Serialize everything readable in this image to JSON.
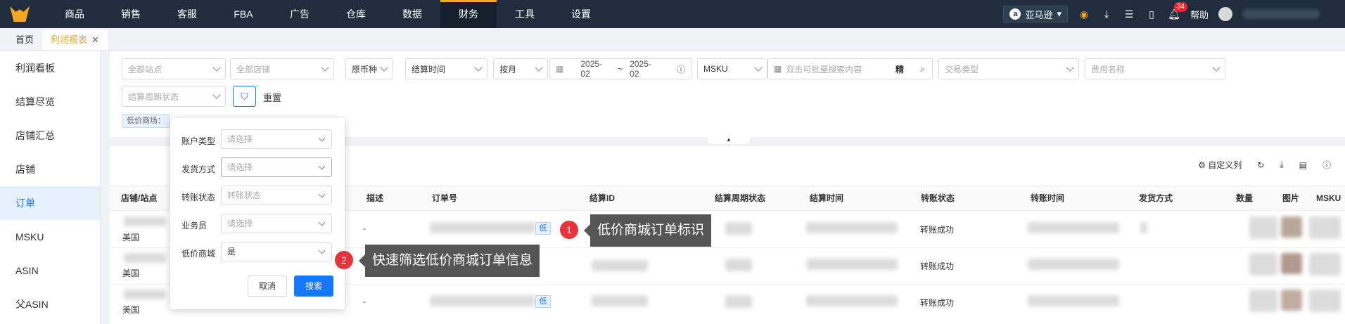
{
  "nav": [
    "商品",
    "销售",
    "客服",
    "FBA",
    "广告",
    "仓库",
    "数据",
    "财务",
    "工具",
    "设置"
  ],
  "nav_active": "财务",
  "topright": {
    "store": "亚马逊",
    "help": "帮助",
    "badge": "34"
  },
  "tabs": {
    "home": "首页",
    "current": "利润报表",
    "close": "✕"
  },
  "sidebar": [
    "利润看板",
    "结算尽览",
    "店铺汇总",
    "店铺",
    "订单",
    "MSKU",
    "ASIN",
    "父ASIN"
  ],
  "sidebar_active": "订单",
  "filters": {
    "site": "全部站点",
    "shop": "全部店铺",
    "currency": "原币种",
    "time_type": "结算时间",
    "period": "按月",
    "date_from": "2025-02",
    "date_sep": "~",
    "date_to": "2025-02",
    "msku": "MSKU",
    "search_placeholder": "双击可批量搜索内容",
    "exact": "精",
    "trade_type": "交易类型",
    "fee_name": "费用名称",
    "cycle_status": "结算周期状态",
    "reset": "重置",
    "chip": "低价商场："
  },
  "tools": {
    "custom_cols": "自定义列"
  },
  "columns": [
    "店铺/站点",
    "描述",
    "订单号",
    "结算ID",
    "结算周期状态",
    "结算时间",
    "转账状态",
    "转账时间",
    "发货方式",
    "数量",
    "图片",
    "MSKU"
  ],
  "rows": [
    {
      "site": "美国",
      "desc": "-",
      "low": "低",
      "transfer": "转账成功"
    },
    {
      "site": "美国",
      "desc": "",
      "low": "",
      "transfer": "转账成功"
    },
    {
      "site": "美国",
      "desc": "-",
      "low": "低",
      "transfer": "转账成功"
    }
  ],
  "popup": {
    "account_type": {
      "label": "账户类型",
      "ph": "请选择"
    },
    "ship_method": {
      "label": "发货方式",
      "ph": "请选择"
    },
    "transfer_status": {
      "label": "转账状态",
      "ph": "转账状态"
    },
    "salesperson": {
      "label": "业务员",
      "ph": "请选择"
    },
    "low_price_mall": {
      "label": "低价商城",
      "value": "是"
    },
    "cancel": "取消",
    "search": "搜索"
  },
  "callouts": [
    {
      "num": "1",
      "text": "低价商城订单标识"
    },
    {
      "num": "2",
      "text": "快速筛选低价商城订单信息"
    }
  ]
}
